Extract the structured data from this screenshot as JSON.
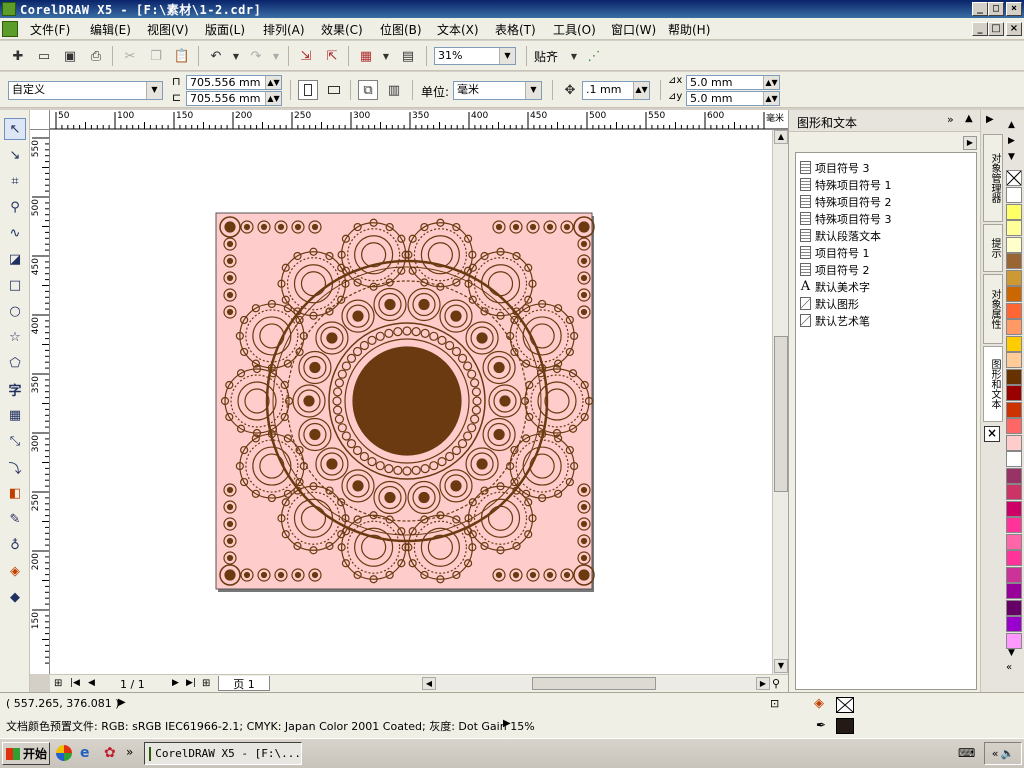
{
  "window": {
    "title": "CorelDRAW X5 - [F:\\素材\\1-2.cdr]",
    "minimize": "_",
    "maximize": "□",
    "close": "×"
  },
  "menu": [
    "文件(F)",
    "编辑(E)",
    "视图(V)",
    "版面(L)",
    "排列(A)",
    "效果(C)",
    "位图(B)",
    "文本(X)",
    "表格(T)",
    "工具(O)",
    "窗口(W)",
    "帮助(H)"
  ],
  "toolbar": {
    "zoom": "31%",
    "snap_label": "贴齐"
  },
  "propbar": {
    "paper_preset": "自定义",
    "width": "705.556 mm",
    "height": "705.556 mm",
    "units_label": "单位:",
    "units": "毫米",
    "nudge": ".1 mm",
    "dup_x": "5.0 mm",
    "dup_y": "5.0 mm"
  },
  "ruler": {
    "top_ticks": [
      "50",
      "100",
      "150",
      "200",
      "250",
      "300",
      "350",
      "400",
      "450",
      "500",
      "550",
      "600",
      "毫米"
    ],
    "left_ticks": [
      "550",
      "500",
      "450",
      "400",
      "350",
      "300",
      "250",
      "200",
      "150"
    ]
  },
  "pages": {
    "counter": "1 / 1",
    "tab": "页 1"
  },
  "docker": {
    "title": "图形和文本",
    "items": [
      {
        "label": "项目符号 3",
        "icon": "paragraph-style-icon"
      },
      {
        "label": "特殊项目符号 1",
        "icon": "paragraph-style-icon"
      },
      {
        "label": "特殊项目符号 2",
        "icon": "paragraph-style-icon"
      },
      {
        "label": "特殊项目符号 3",
        "icon": "paragraph-style-icon"
      },
      {
        "label": "默认段落文本",
        "icon": "paragraph-style-icon"
      },
      {
        "label": "项目符号 1",
        "icon": "paragraph-style-icon"
      },
      {
        "label": "项目符号 2",
        "icon": "paragraph-style-icon"
      },
      {
        "label": "默认美术字",
        "icon": "artistic-text-icon"
      },
      {
        "label": "默认图形",
        "icon": "graphic-style-icon"
      },
      {
        "label": "默认艺术笔",
        "icon": "graphic-style-icon"
      }
    ],
    "tabs": [
      "对象管理器",
      "提示",
      "对象属性",
      "图形和文本"
    ]
  },
  "palette": {
    "colors": [
      "#ffffff",
      "#ffff66",
      "#ffff99",
      "#ffffcc",
      "#996633",
      "#cc9933",
      "#cc6600",
      "#ff6633",
      "#ff9966",
      "#ffcc00",
      "#ffcc99",
      "#663300",
      "#990000",
      "#cc3300",
      "#ff6666",
      "#ffcccc",
      "#ffffff",
      "#993366",
      "#cc3366",
      "#cc0066",
      "#ff3399",
      "#ff66aa",
      "#ff3399",
      "#cc3399",
      "#990099",
      "#660066",
      "#9900cc",
      "#ff99ff"
    ]
  },
  "status": {
    "coords": "( 557.265, 376.081 )",
    "color_profile": "文档颜色预置文件: RGB: sRGB IEC61966-2.1; CMYK: Japan Color 2001 Coated; 灰度: Dot Gain 15%"
  },
  "taskbar": {
    "start": "开始",
    "task": "CorelDRAW X5 - [F:\\..."
  },
  "colors": {
    "page_bg": "#ffcccc",
    "artwork": "#6b3a10"
  }
}
